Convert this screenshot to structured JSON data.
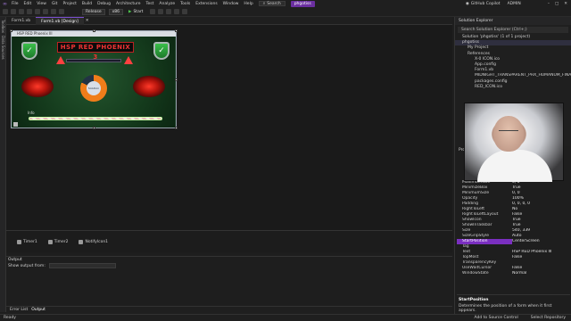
{
  "menu": {
    "items": [
      "File",
      "Edit",
      "View",
      "Git",
      "Project",
      "Build",
      "Debug",
      "Architecture",
      "Test",
      "Analyze",
      "Tools",
      "Extensions",
      "Window",
      "Help"
    ],
    "search_label": "Search",
    "solution_name": "phgotiss",
    "copilot_label": "GitHub Copilot",
    "admin_label": "ADMIN"
  },
  "toolbar": {
    "config": "Release",
    "platform": "x86",
    "start_label": "Start"
  },
  "left_strip": {
    "tabs": [
      "Toolbox",
      "Data Sources"
    ]
  },
  "doc_tabs": [
    {
      "label": "Form1.vb"
    },
    {
      "label": "Form1.vb [Design]"
    }
  ],
  "designer": {
    "form_title": "HSP RED Phoenix III",
    "banner_text": "HSP RED PHOENIX 3",
    "gauge_text": "Solution",
    "info_label": "Info",
    "gauge_fill": 0.82,
    "progress_fraction": 1.0
  },
  "tray": {
    "components": [
      "Timer1",
      "Timer2",
      "NotifyIcon1"
    ]
  },
  "output": {
    "title": "Output",
    "show_from_label": "Show output from:"
  },
  "bottom_tabs": [
    "Error List",
    "Output"
  ],
  "status": {
    "left": "Ready",
    "add_source": "Add to Source Control",
    "select_repo": "Select Repository"
  },
  "solution_explorer": {
    "title": "Solution Explorer",
    "search_placeholder": "Search Solution Explorer (Ctrl+;)",
    "tree": [
      {
        "label": "Solution 'phgotiss' (1 of 1 project)",
        "level": 1
      },
      {
        "label": "phgotiss",
        "level": 1
      },
      {
        "label": "My Project",
        "level": 2
      },
      {
        "label": "References",
        "level": 2
      },
      {
        "label": "X-0 ICON.ico",
        "level": 3
      },
      {
        "label": "App.config",
        "level": 3
      },
      {
        "label": "Form1.vb",
        "level": 3
      },
      {
        "label": "MIDNIGHT_TRANSPARENT_PHX_HUMANUM_FINAL.co",
        "level": 3
      },
      {
        "label": "packages.config",
        "level": 3
      },
      {
        "label": "RED_ICON.ico",
        "level": 3
      }
    ]
  },
  "properties": {
    "title": "Properties",
    "rows": [
      {
        "name": "MaximumSize",
        "value": "0, 0"
      },
      {
        "name": "MinimizeBox",
        "value": "True"
      },
      {
        "name": "MinimumSize",
        "value": "0, 0"
      },
      {
        "name": "Opacity",
        "value": "100%"
      },
      {
        "name": "Padding",
        "value": "0, 0, 0, 0"
      },
      {
        "name": "RightToLeft",
        "value": "No"
      },
      {
        "name": "RightToLeftLayout",
        "value": "False"
      },
      {
        "name": "ShowIcon",
        "value": "True"
      },
      {
        "name": "ShowInTaskbar",
        "value": "True"
      },
      {
        "name": "Size",
        "value": "540, 339"
      },
      {
        "name": "SizeGripStyle",
        "value": "Auto"
      },
      {
        "name": "StartPosition",
        "value": "CenterScreen",
        "selected": true
      },
      {
        "name": "Tag",
        "value": ""
      },
      {
        "name": "Text",
        "value": "HSP RED Phoenix III"
      },
      {
        "name": "TopMost",
        "value": "False"
      },
      {
        "name": "TransparencyKey",
        "value": ""
      },
      {
        "name": "UseWaitCursor",
        "value": "False"
      },
      {
        "name": "WindowState",
        "value": "Normal"
      }
    ],
    "desc_title": "StartPosition",
    "desc_text": "Determines the position of a form when it first appears."
  },
  "colors": {
    "accent": "#7a2fc0",
    "form_bg": "#1a3c24",
    "banner_text": "#e33333",
    "gauge_fill": "#f07d1a"
  }
}
